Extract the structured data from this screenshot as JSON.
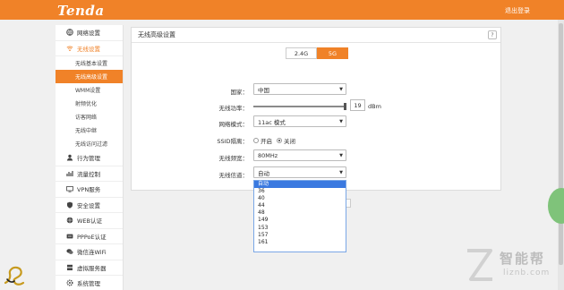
{
  "header": {
    "logo": "Tenda",
    "logout": "退出登录"
  },
  "sidebar": {
    "items": [
      {
        "label": "网络设置",
        "icon": "globe-icon"
      },
      {
        "label": "无线设置",
        "icon": "wifi-icon"
      },
      {
        "label": "行为管理",
        "icon": "user-icon"
      },
      {
        "label": "流量控制",
        "icon": "traffic-icon"
      },
      {
        "label": "VPN服务",
        "icon": "vpn-icon"
      },
      {
        "label": "安全设置",
        "icon": "shield-icon"
      },
      {
        "label": "WEB认证",
        "icon": "web-icon"
      },
      {
        "label": "PPPoE认证",
        "icon": "pppoe-icon"
      },
      {
        "label": "微信连WiFi",
        "icon": "wechat-icon"
      },
      {
        "label": "虚拟服务器",
        "icon": "server-icon"
      },
      {
        "label": "系统管理",
        "icon": "gear-icon"
      }
    ],
    "wireless_sub": [
      {
        "label": "无线基本设置",
        "active": false
      },
      {
        "label": "无线高级设置",
        "active": true
      },
      {
        "label": "WMM设置",
        "active": false
      },
      {
        "label": "射频优化",
        "active": false
      },
      {
        "label": "访客网络",
        "active": false
      },
      {
        "label": "无线中继",
        "active": false
      },
      {
        "label": "无线访问过滤",
        "active": false
      }
    ]
  },
  "panel": {
    "title": "无线高级设置",
    "help": "?",
    "bands": [
      "2.4G",
      "5G"
    ],
    "active_band": "5G",
    "country": {
      "label": "国家：",
      "value": "中国"
    },
    "power": {
      "label": "无线功率：",
      "value": "19",
      "unit": "dBm",
      "level": 1.0
    },
    "mode": {
      "label": "网络模式：",
      "value": "11ac 模式"
    },
    "ssid_isolation": {
      "label": "SSID隔离：",
      "options": [
        "开启",
        "关闭"
      ],
      "selected": "关闭"
    },
    "bandwidth": {
      "label": "无线频宽：",
      "value": "80MHz"
    },
    "channel": {
      "label": "无线信道：",
      "value": "自动",
      "options": [
        "自动",
        "36",
        "40",
        "44",
        "48",
        "149",
        "153",
        "157",
        "161"
      ]
    }
  },
  "watermark": {
    "brand": "智能帮",
    "domain": "liznb.com"
  },
  "colors": {
    "accent": "#f08228",
    "selected_option": "#3a79e0"
  }
}
